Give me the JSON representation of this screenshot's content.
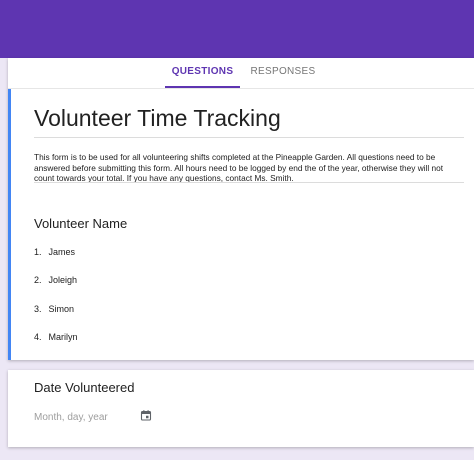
{
  "tabs": [
    {
      "label": "QUESTIONS"
    },
    {
      "label": "RESPONSES"
    }
  ],
  "form": {
    "title": "Volunteer Time Tracking",
    "description": "This form is to be used for all volunteering shifts completed at the Pineapple Garden. All questions need to be answered before submitting this form. All hours need to be logged by end the of the year, otherwise they will not count towards your total. If you have any questions, contact Ms. Smith."
  },
  "questions": [
    {
      "title": "Volunteer Name",
      "options": [
        {
          "num": "1.",
          "label": "James"
        },
        {
          "num": "2.",
          "label": "Joleigh"
        },
        {
          "num": "3.",
          "label": "Simon"
        },
        {
          "num": "4.",
          "label": "Marilyn"
        }
      ]
    },
    {
      "title": "Date Volunteered",
      "placeholder": "Month, day, year"
    }
  ],
  "colors": {
    "header": "#5e35b1",
    "accent": "#5e35b1",
    "focus": "#4285f4",
    "background": "#ece7f5"
  },
  "icons": {
    "date_picker": "calendar-icon"
  }
}
